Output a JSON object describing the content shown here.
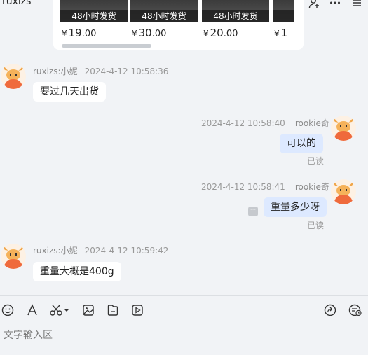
{
  "header": {
    "title": "ruxizs"
  },
  "products": [
    {
      "badge": "48小时发货",
      "price_yen": "¥",
      "price_int": "19",
      "price_dec": ".00"
    },
    {
      "badge": "48小时发货",
      "price_yen": "¥",
      "price_int": "30",
      "price_dec": ".00"
    },
    {
      "badge": "48小时发货",
      "price_yen": "¥",
      "price_int": "20",
      "price_dec": ".00"
    },
    {
      "badge": "4",
      "price_yen": "¥",
      "price_int": "1",
      "price_dec": ""
    }
  ],
  "messages": [
    {
      "sender": "ruxizs:小妮",
      "time": "2024-4-12 10:58:36",
      "text": "要过几天出货",
      "direction": "in"
    },
    {
      "sender": "rookie奇",
      "time": "2024-4-12 10:58:40",
      "text": "可以的",
      "direction": "out",
      "status": "已读"
    },
    {
      "sender": "rookie奇",
      "time": "2024-4-12 10:58:41",
      "text": "重量多少呀",
      "direction": "out",
      "status": "已读"
    },
    {
      "sender": "ruxizs:小妮",
      "time": "2024-4-12 10:59:42",
      "text": "重量大概是400g",
      "direction": "in"
    }
  ],
  "toolbar": {
    "icons": [
      "emoji-icon",
      "font-icon",
      "scissors-icon",
      "image-icon",
      "file-icon",
      "video-icon",
      "share-icon",
      "history-icon"
    ]
  },
  "input": {
    "placeholder": "文字输入区"
  },
  "colors": {
    "bubble_out": "#dde9ff",
    "bubble_in": "#ffffff",
    "background": "#f1f3f6"
  }
}
